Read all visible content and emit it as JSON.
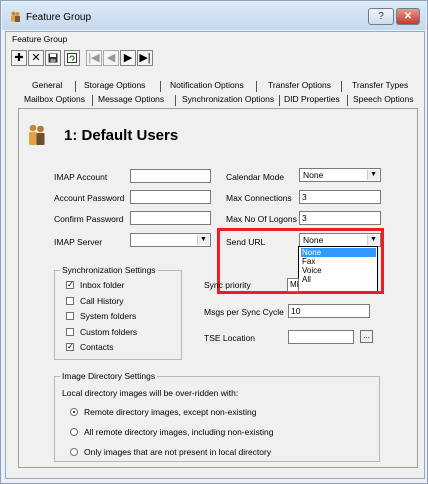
{
  "window": {
    "title": "Feature Group",
    "help_label": "?",
    "close_label": "✕"
  },
  "menu": {
    "label": "Feature Group"
  },
  "toolbar": {
    "add": "✚",
    "delete": "✕",
    "save": "💾",
    "refresh": "🔃",
    "first": "|◀",
    "prev": "◀",
    "next": "▶",
    "last": "▶|"
  },
  "tabs_row1": [
    "General",
    "Storage Options",
    "Notification Options",
    "Transfer Options",
    "Transfer Types"
  ],
  "tabs_row2": [
    "Mailbox Options",
    "Message Options",
    "Synchronization Options",
    "DID Properties",
    "Speech Options"
  ],
  "heading": "1: Default Users",
  "form": {
    "imap_account_label": "IMAP Account",
    "imap_account_value": "",
    "account_password_label": "Account Password",
    "account_password_value": "",
    "confirm_password_label": "Confirm Password",
    "confirm_password_value": "",
    "imap_server_label": "IMAP Server",
    "imap_server_value": "",
    "calendar_mode_label": "Calendar Mode",
    "calendar_mode_value": "None",
    "max_connections_label": "Max Connections",
    "max_connections_value": "3",
    "max_logons_label": "Max No Of Logons",
    "max_logons_value": "3",
    "send_url_label": "Send URL",
    "send_url_value": "None",
    "send_url_options": [
      "None",
      "Fax",
      "Voice",
      "All"
    ],
    "sync_priority_label": "Sync priority",
    "sync_priority_value": "Mi",
    "msgs_per_sync_label": "Msgs per Sync Cycle",
    "msgs_per_sync_value": "10",
    "tse_location_label": "TSE Location",
    "tse_location_value": "",
    "browse_label": "..."
  },
  "sync_settings": {
    "legend": "Synchronization Settings",
    "items": [
      {
        "label": "Inbox folder",
        "checked": true
      },
      {
        "label": "Call History",
        "checked": false
      },
      {
        "label": "System folders",
        "checked": false
      },
      {
        "label": "Custom folders",
        "checked": false
      },
      {
        "label": "Contacts",
        "checked": true
      }
    ]
  },
  "image_settings": {
    "legend": "Image Directory Settings",
    "description": "Local directory images will be over-ridden with:",
    "options": [
      {
        "label": "Remote directory images, except non-existing",
        "selected": true
      },
      {
        "label": "All remote directory images, including non-existing",
        "selected": false
      },
      {
        "label": "Only images that are not present in local directory",
        "selected": false
      }
    ]
  },
  "colors": {
    "highlight_box": "#ee1c25",
    "selection": "#3399ff"
  }
}
